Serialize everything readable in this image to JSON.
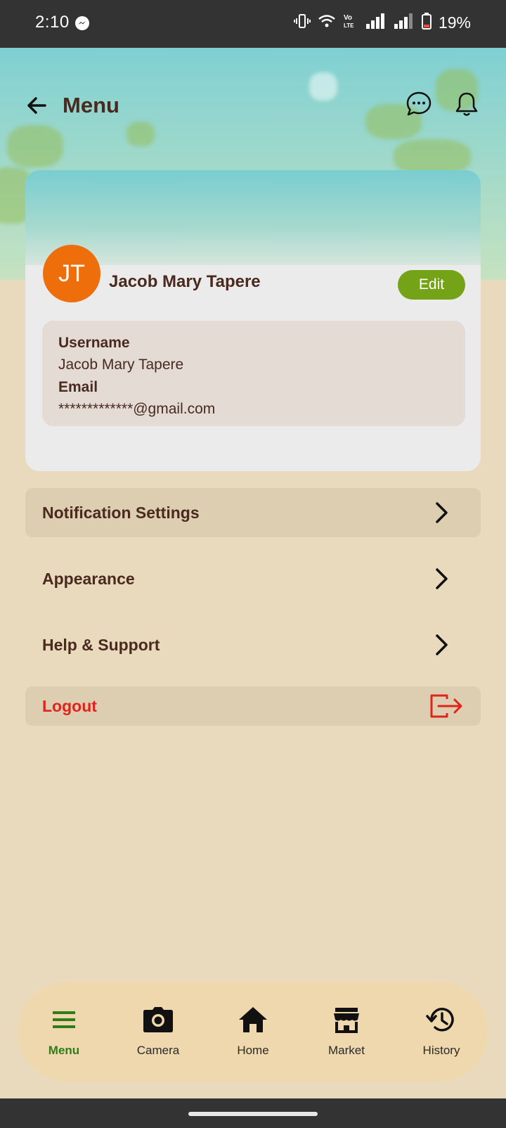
{
  "status_bar": {
    "time": "2:10",
    "battery": "19%",
    "icons": [
      "messenger-icon",
      "vibrate-icon",
      "wifi-icon",
      "volte-icon",
      "signal-icon",
      "signal-icon",
      "battery-icon"
    ]
  },
  "app_bar": {
    "title": "Menu",
    "back_icon": "arrow-left-icon",
    "chat_icon": "chat-bubble-icon",
    "bell_icon": "bell-icon"
  },
  "profile": {
    "initials": "JT",
    "name": "Jacob Mary Tapere",
    "edit_label": "Edit",
    "username_label": "Username",
    "username_value": "Jacob Mary Tapere",
    "email_label": "Email",
    "email_value": "*************@gmail.com"
  },
  "menu": {
    "notification_settings": "Notification Settings",
    "appearance": "Appearance",
    "help_support": "Help & Support",
    "logout": "Logout"
  },
  "bottom_nav": {
    "items": [
      {
        "label": "Menu",
        "icon": "hamburger-icon",
        "active": true
      },
      {
        "label": "Camera",
        "icon": "camera-icon",
        "active": false
      },
      {
        "label": "Home",
        "icon": "home-icon",
        "active": false
      },
      {
        "label": "Market",
        "icon": "store-icon",
        "active": false
      },
      {
        "label": "History",
        "icon": "history-icon",
        "active": false
      }
    ]
  },
  "colors": {
    "accent_green": "#74a317",
    "avatar_orange": "#ee6e0c",
    "logout_red": "#e0241b",
    "page_bg": "#e9dabd"
  }
}
